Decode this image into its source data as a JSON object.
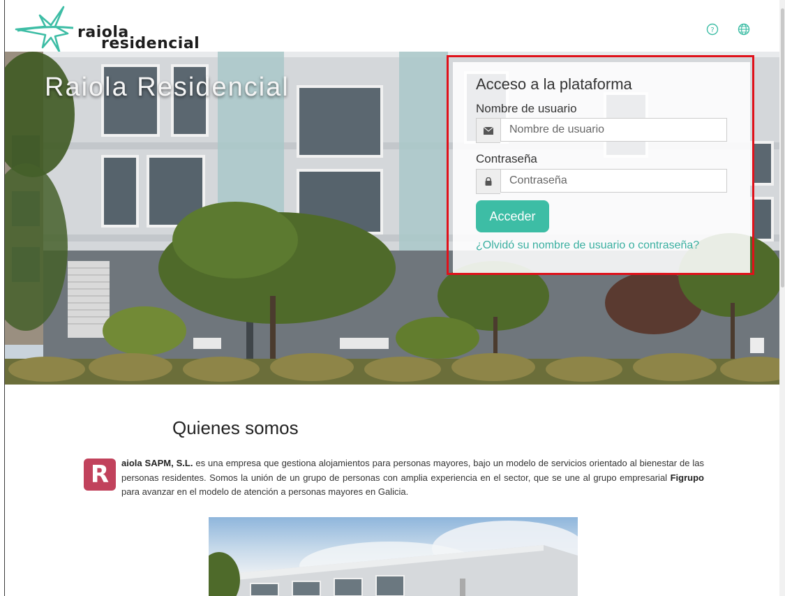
{
  "header": {
    "logo_line1": "raiola",
    "logo_line2": "residencial",
    "icons": [
      "help-icon",
      "globe-icon"
    ]
  },
  "hero": {
    "title": "Raiola Residencial"
  },
  "login": {
    "title": "Acceso a la plataforma",
    "username_label": "Nombre de usuario",
    "username_placeholder": "Nombre de usuario",
    "password_label": "Contraseña",
    "password_placeholder": "Contraseña",
    "submit_label": "Acceder",
    "forgot_link": "¿Olvidó su nombre de usuario o contraseña?"
  },
  "about": {
    "title": "Quienes somos",
    "badge_letter": "R",
    "company_name": "aiola SAPM, S.L.",
    "text_part1": " es una empresa que gestiona alojamientos para personas mayores, bajo un modelo de servicios orientado al bienestar de las personas residentes. Somos la unión de un grupo de personas con amplia experiencia en el sector, que se une al grupo empresarial ",
    "group_name": "Figrupo",
    "text_part2": " para avanzar en el modelo de atención a personas mayores en Galicia."
  },
  "colors": {
    "accent": "#3dbda5",
    "link": "#3aafa0",
    "badge": "#c1425c",
    "highlight_outline": "#e0111a"
  }
}
